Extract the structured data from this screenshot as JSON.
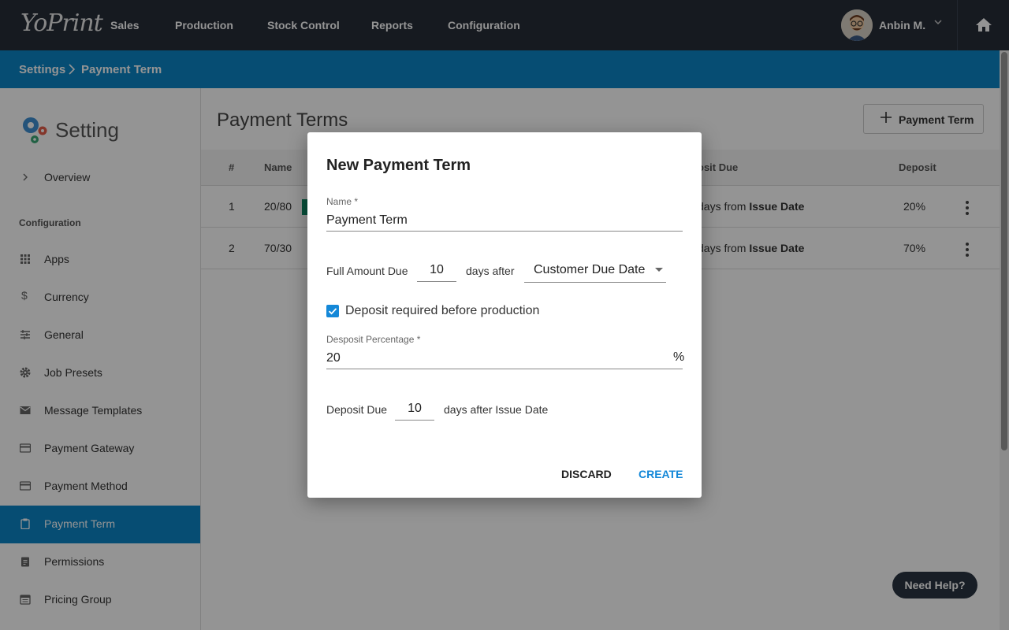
{
  "app": {
    "logo": "YoPrint"
  },
  "nav": {
    "items": [
      "Sales",
      "Production",
      "Stock Control",
      "Reports",
      "Configuration"
    ]
  },
  "user": {
    "name": "Anbin M."
  },
  "breadcrumb": {
    "items": [
      "Settings",
      "Payment Term"
    ]
  },
  "sidebar": {
    "title": "Setting",
    "overview": "Overview",
    "section": "Configuration",
    "items": [
      {
        "label": "Apps",
        "icon": "grid-icon"
      },
      {
        "label": "Currency",
        "icon": "dollar-icon"
      },
      {
        "label": "General",
        "icon": "sliders-icon"
      },
      {
        "label": "Job Presets",
        "icon": "gear-icon"
      },
      {
        "label": "Message Templates",
        "icon": "envelope-icon"
      },
      {
        "label": "Payment Gateway",
        "icon": "credit-card-icon"
      },
      {
        "label": "Payment Method",
        "icon": "credit-card-icon"
      },
      {
        "label": "Payment Term",
        "icon": "clipboard-icon",
        "active": true
      },
      {
        "label": "Permissions",
        "icon": "clipboard-list-icon"
      },
      {
        "label": "Pricing Group",
        "icon": "calendar-icon"
      }
    ]
  },
  "main": {
    "title": "Payment Terms",
    "add_button": "Payment Term",
    "columns": {
      "num": "#",
      "name": "Name",
      "deposit_due": "osit Due",
      "deposit": "Deposit"
    },
    "rows": [
      {
        "num": "1",
        "name": "20/80",
        "due_prefix": "days from ",
        "due_bold": "Issue Date",
        "deposit": "20%"
      },
      {
        "num": "2",
        "name": "70/30",
        "due_prefix": "days from ",
        "due_bold": "Issue Date",
        "deposit": "70%"
      }
    ]
  },
  "modal": {
    "title": "New Payment Term",
    "name_label": "Name *",
    "name_value": "Payment Term",
    "full_due_label": "Full Amount Due",
    "full_due_days": "10",
    "days_after": "days after",
    "due_basis": "Customer Due Date",
    "deposit_check_label": "Deposit required before production",
    "deposit_checked": true,
    "deposit_pct_label": "Desposit Percentage *",
    "deposit_pct_value": "20",
    "pct_sign": "%",
    "deposit_due_label": "Deposit Due",
    "deposit_due_days": "10",
    "deposit_due_suffix": "days after Issue Date",
    "discard": "DISCARD",
    "create": "CREATE"
  },
  "help": {
    "label": "Need Help?"
  },
  "colors": {
    "topbar": "#262d38",
    "primary": "#0c85c6",
    "tag": "#0d8a66",
    "checkbox": "#1488d8"
  }
}
